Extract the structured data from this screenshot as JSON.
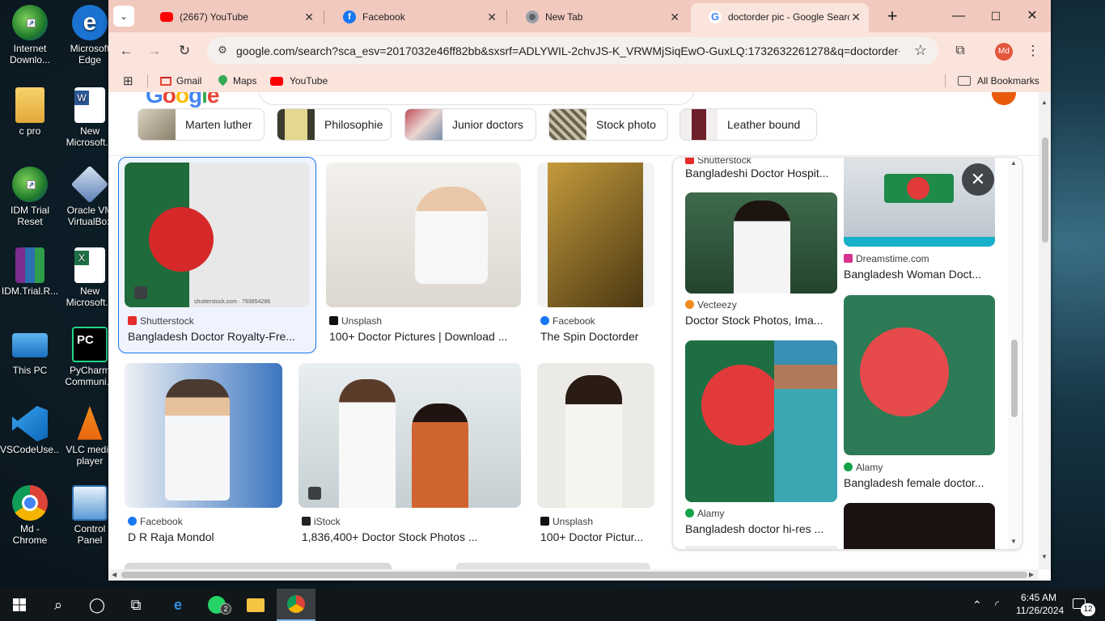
{
  "desktop": {
    "icons": [
      {
        "label": "Internet\nDownlo..."
      },
      {
        "label": "Microsoft\nEdge"
      },
      {
        "label": "c pro"
      },
      {
        "label": "New\nMicrosoft..."
      },
      {
        "label": "IDM Trial\nReset"
      },
      {
        "label": "Oracle VM\nVirtualBox"
      },
      {
        "label": "IDM.Trial.R..."
      },
      {
        "label": "New\nMicrosoft..."
      },
      {
        "label": "This PC"
      },
      {
        "label": "PyCharm\nCommuni..."
      },
      {
        "label": "VSCodeUse..."
      },
      {
        "label": "VLC media\nplayer"
      },
      {
        "label": "Md -\nChrome"
      },
      {
        "label": "Control\nPanel"
      }
    ]
  },
  "browser": {
    "tabs": [
      {
        "title": "(2667) YouTube",
        "icon": "youtube-icon"
      },
      {
        "title": "Facebook",
        "icon": "facebook-icon"
      },
      {
        "title": "New Tab",
        "icon": "chrome-icon"
      },
      {
        "title": "doctorder pic - Google Searc",
        "icon": "google-icon"
      }
    ],
    "url": "google.com/search?sca_esv=2017032e46ff82bb&sxsrf=ADLYWIL-2chvJS-K_VRWMjSiqEwO-GuxLQ:1732632261278&q=doctorder+p...",
    "profile_initials": "Md",
    "bookmarks": [
      {
        "label": "Gmail"
      },
      {
        "label": "Maps"
      },
      {
        "label": "YouTube"
      }
    ],
    "all_bookmarks": "All Bookmarks"
  },
  "search": {
    "chips": [
      "Marten luther",
      "Philosophie",
      "Junior doctors",
      "Stock photo",
      "Leather bound"
    ],
    "results": [
      {
        "source": "Shutterstock",
        "title": "Bangladesh Doctor Royalty-Fre..."
      },
      {
        "source": "Unsplash",
        "title": "100+ Doctor Pictures | Download ..."
      },
      {
        "source": "Facebook",
        "title": "The Spin Doctorder"
      },
      {
        "source": "Facebook",
        "title": "D R Raja Mondol"
      },
      {
        "source": "iStock",
        "title": "1,836,400+ Doctor Stock Photos ..."
      },
      {
        "source": "Unsplash",
        "title": "100+ Doctor Pictur..."
      }
    ],
    "side_panel": {
      "partial_source": "Shutterstock",
      "partial_title": "Bangladeshi Doctor Hospit...",
      "items": [
        {
          "source": "Vecteezy",
          "title": "Doctor Stock Photos, Ima..."
        },
        {
          "source": "Alamy",
          "title": "Bangladesh doctor hi-res ..."
        },
        {
          "source": "Dreamstime.com",
          "title": "Bangladesh Woman Doct..."
        },
        {
          "source": "Alamy",
          "title": "Bangladesh female doctor..."
        }
      ]
    },
    "image_caption": "shutterstock.com · 793854286"
  },
  "taskbar": {
    "time": "6:45 AM",
    "date": "11/26/2024",
    "notification_count": "12",
    "whatsapp_badge": "2"
  }
}
